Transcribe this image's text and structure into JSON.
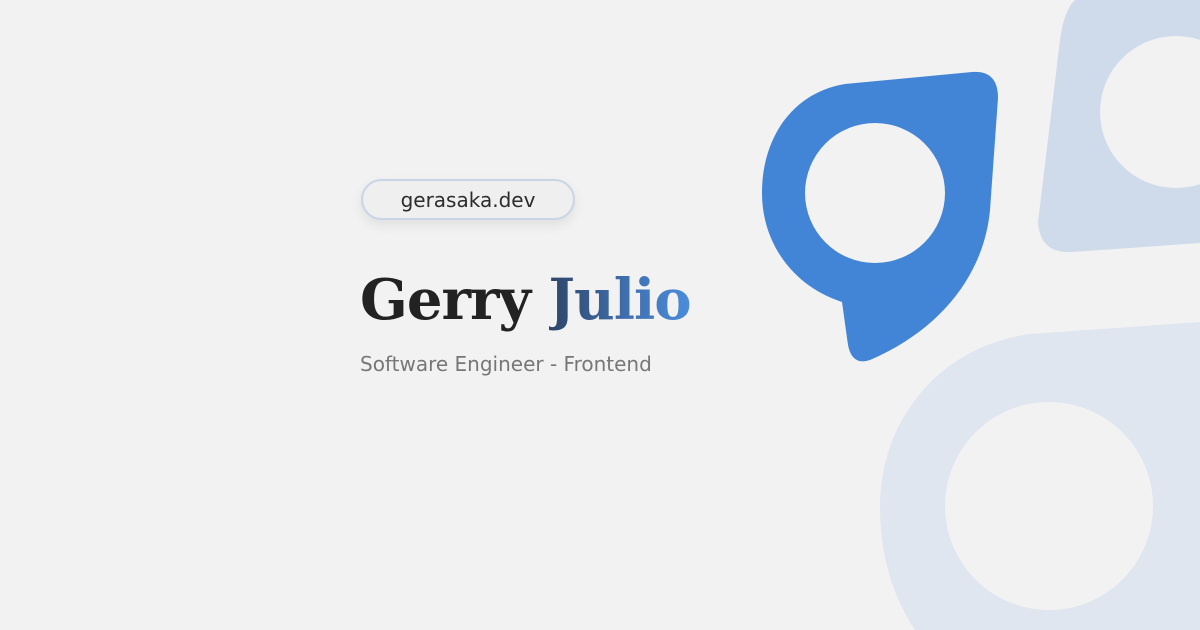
{
  "badge": {
    "domain": "gerasaka.dev"
  },
  "hero": {
    "first_name": "Gerry",
    "last_name": "Julio",
    "subtitle": "Software Engineer - Frontend"
  },
  "graphics": {
    "pin_icon": "map-pin-icon",
    "accent_color": "#4285d7",
    "light_shape_color": "#cfdbeb",
    "lighter_shape_color": "#dfe6f0",
    "background_color": "#f2f2f2"
  }
}
